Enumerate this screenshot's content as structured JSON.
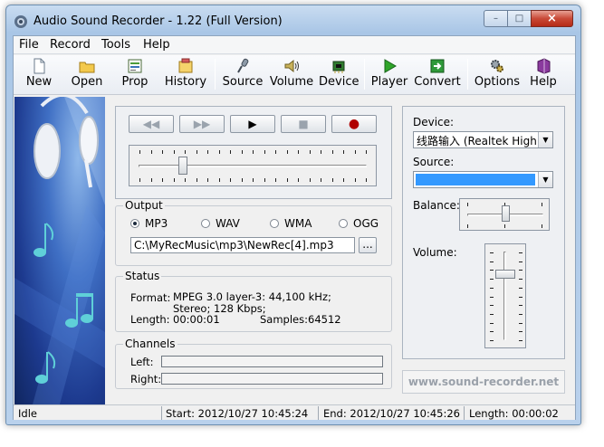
{
  "window": {
    "title": "Audio Sound Recorder - 1.22 (Full Version)",
    "controls": {
      "minimize": "–",
      "maximize": "□",
      "close": "×"
    }
  },
  "menu": [
    "File",
    "Record",
    "Tools",
    "Help"
  ],
  "toolbar": [
    {
      "label": "New",
      "icon": "new-file-icon"
    },
    {
      "label": "Open",
      "icon": "open-folder-icon"
    },
    {
      "label": "Prop",
      "icon": "properties-icon"
    },
    {
      "label": "History",
      "icon": "history-icon"
    },
    {
      "label": "Source",
      "icon": "microphone-icon"
    },
    {
      "label": "Volume",
      "icon": "speaker-icon"
    },
    {
      "label": "Device",
      "icon": "device-chip-icon"
    },
    {
      "label": "Player",
      "icon": "play-green-icon"
    },
    {
      "label": "Convert",
      "icon": "convert-arrow-icon"
    },
    {
      "label": "Options",
      "icon": "gears-icon"
    },
    {
      "label": "Help",
      "icon": "help-book-icon"
    }
  ],
  "transport": {
    "rewind": "◀◀",
    "forward": "▶▶",
    "play": "▶",
    "stop": "■",
    "record": "●",
    "position": 0.12
  },
  "output": {
    "label": "Output",
    "formats": [
      "MP3",
      "WAV",
      "WMA",
      "OGG"
    ],
    "selected": "MP3",
    "path": "C:\\MyRecMusic\\mp3\\NewRec[4].mp3",
    "browse": "..."
  },
  "status": {
    "label": "Status",
    "format_label": "Format:",
    "format_value": "MPEG 3.0 layer-3: 44,100 kHz; Stereo; 128 Kbps;",
    "length_label": "Length:",
    "length_value": "00:00:01",
    "samples_label": "Samples:",
    "samples_value": "64512"
  },
  "channels": {
    "label": "Channels",
    "left": "Left:",
    "right": "Right:"
  },
  "device": {
    "label": "Device:",
    "value": "线路输入 (Realtek High De"
  },
  "source": {
    "label": "Source:",
    "value": ""
  },
  "balance": {
    "label": "Balance:",
    "level": 0.5
  },
  "volume": {
    "label": "Volume:",
    "level": 0.75
  },
  "website": "www.sound-recorder.net",
  "statusbar": {
    "state": "Idle",
    "start": "Start: 2012/10/27 10:45:24",
    "end": "End: 2012/10/27 10:45:26",
    "length": "Length: 00:00:02"
  },
  "colors": {
    "title_bar": "#b9d1ec",
    "source_selected": "#3399ff",
    "record_dot": "#b00000",
    "play_green": "#2fa52a"
  }
}
